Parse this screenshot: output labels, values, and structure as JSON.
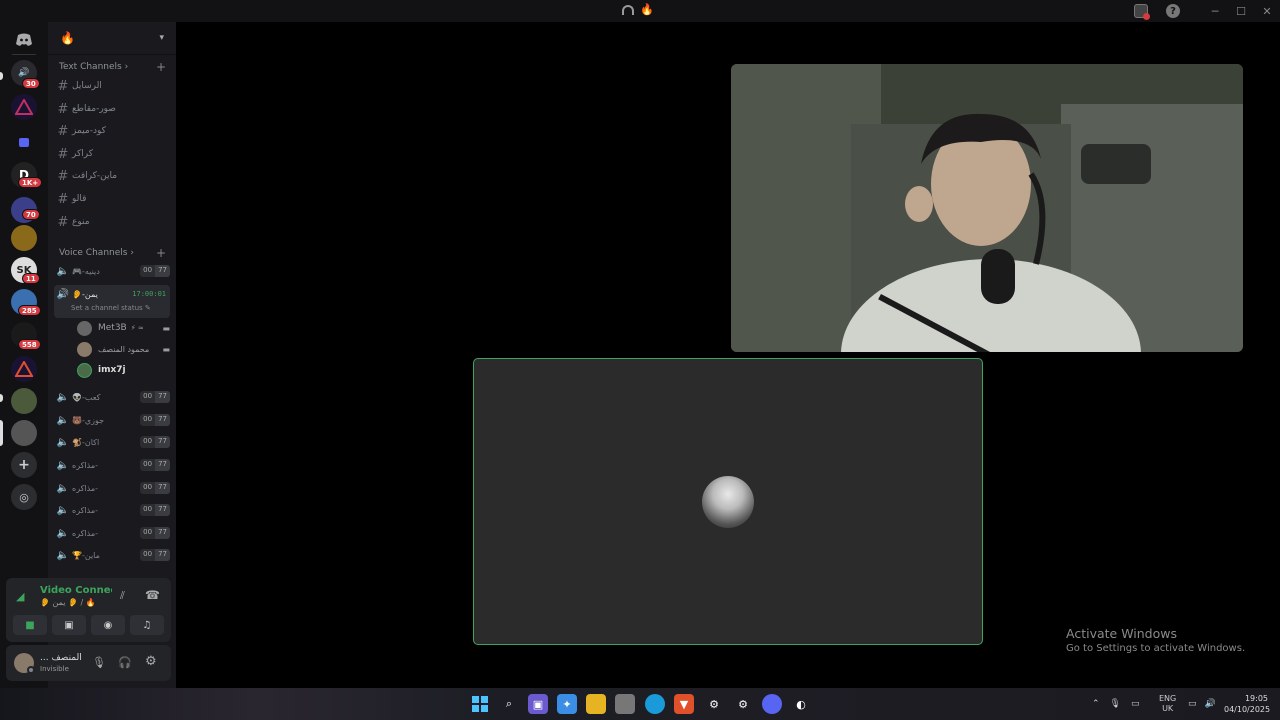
{
  "titlebar": {
    "title_icon": "headset-icon",
    "title_emoji": "🔥"
  },
  "guilds": {
    "discord_home": "discord-logo-icon",
    "badges": [
      "30",
      "1K+",
      "70",
      "11",
      "285",
      "558"
    ]
  },
  "server": {
    "name": "🔥",
    "text_category": "Text Channels",
    "voice_category": "Voice Channels",
    "text_channels": [
      "الرسايل",
      "صور-مقاطع",
      "كود-ميمز",
      "كراكر",
      "ماين-كرافت",
      "قالو",
      "منوع"
    ],
    "voice_channels": [
      {
        "name": "🎮-دينيه",
        "count_a": "00",
        "count_b": "77"
      },
      {
        "name": "👂-يمن",
        "timer": "17:00:01",
        "status": "Set a channel status"
      },
      {
        "name": "👽-كعب",
        "count_a": "00",
        "count_b": "77"
      },
      {
        "name": "🐻-جوزي",
        "count_a": "00",
        "count_b": "77"
      },
      {
        "name": "🐒-اكان",
        "count_a": "00",
        "count_b": "77"
      },
      {
        "name": "مذاكره-",
        "count_a": "00",
        "count_b": "77"
      },
      {
        "name": "مذاكره-",
        "count_a": "00",
        "count_b": "77"
      },
      {
        "name": "مذاكره-",
        "count_a": "00",
        "count_b": "77"
      },
      {
        "name": "مذاكره-",
        "count_a": "00",
        "count_b": "77"
      },
      {
        "name": "🏆-ماين",
        "count_a": "00",
        "count_b": "77"
      }
    ],
    "voice_users": [
      {
        "name": "Met3B",
        "extra": "⚡ ≈"
      },
      {
        "name": "محمود المنصف",
        "extra": ""
      },
      {
        "name": "imx7j",
        "extra": ""
      }
    ]
  },
  "voice_panel": {
    "status": "Video Connected",
    "location": "👂 يمن 👂 / 🔥"
  },
  "user_panel": {
    "name": "... المنصف",
    "status": "Invisible"
  },
  "watermark": {
    "line1": "Activate Windows",
    "line2": "Go to Settings to activate Windows."
  },
  "taskbar": {
    "lang_line1": "ENG",
    "lang_line2": "UK",
    "time": "19:05",
    "date": "04/10/2025"
  }
}
